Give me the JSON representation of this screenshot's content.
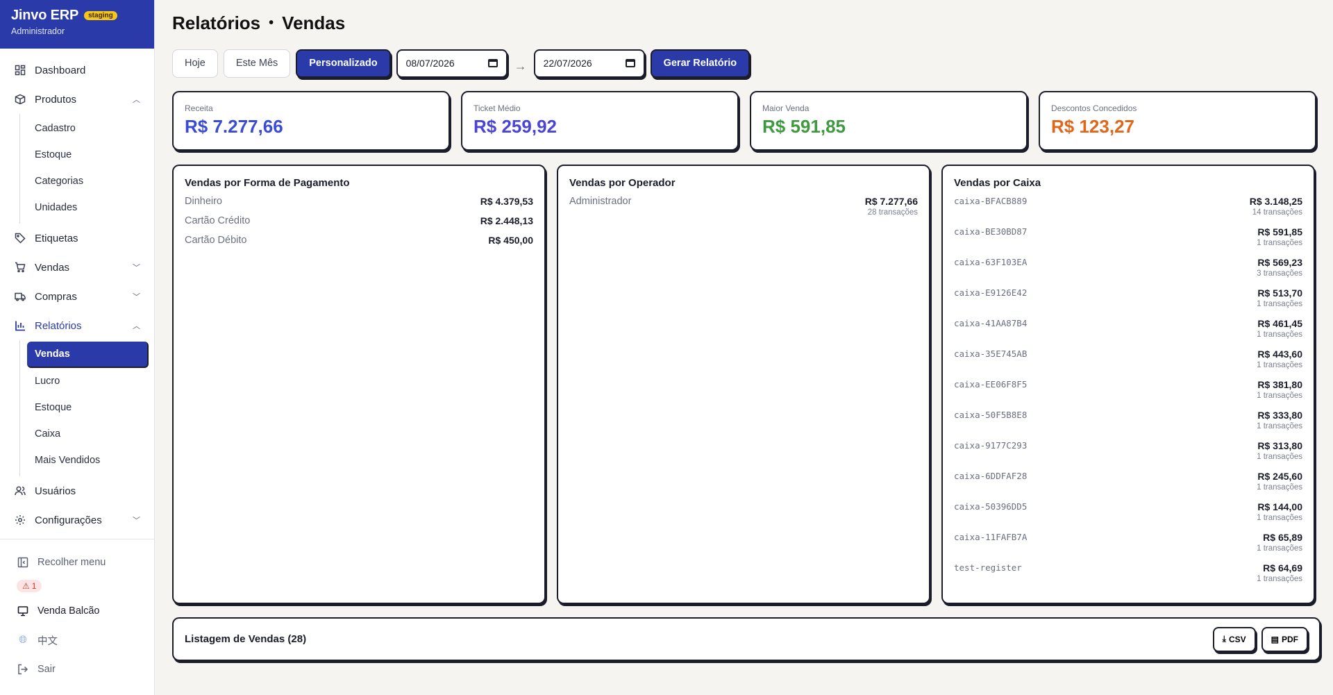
{
  "brand": {
    "title": "Jinvo ERP",
    "badge": "staging",
    "user": "Administrador"
  },
  "nav": {
    "dashboard": "Dashboard",
    "produtos": "Produtos",
    "produtos_sub": [
      "Cadastro",
      "Estoque",
      "Categorias",
      "Unidades"
    ],
    "etiquetas": "Etiquetas",
    "vendas": "Vendas",
    "compras": "Compras",
    "relatorios": "Relatórios",
    "relatorios_sub": [
      "Vendas",
      "Lucro",
      "Estoque",
      "Caixa",
      "Mais Vendidos"
    ],
    "usuarios": "Usuários",
    "configuracoes": "Configurações"
  },
  "footer": {
    "collapse": "Recolher menu",
    "alert_count": "1",
    "venda_balcao": "Venda Balcão",
    "language": "中文",
    "logout": "Sair"
  },
  "page": {
    "section": "Relatórios",
    "separator": "•",
    "title": "Vendas"
  },
  "filters": {
    "today": "Hoje",
    "this_month": "Este Mês",
    "custom": "Personalizado",
    "date_from": "08/07/2026",
    "date_to": "22/07/2026",
    "arrow": "→",
    "generate": "Gerar Relatório"
  },
  "stats": [
    {
      "label": "Receita",
      "value": "R$ 7.277,66",
      "color": "#3a4bd6"
    },
    {
      "label": "Ticket Médio",
      "value": "R$ 259,92",
      "color": "#4b44d8"
    },
    {
      "label": "Maior Venda",
      "value": "R$ 591,85",
      "color": "#3f9a3f"
    },
    {
      "label": "Descontos Concedidos",
      "value": "R$ 123,27",
      "color": "#e0661a"
    }
  ],
  "payment": {
    "title": "Vendas por Forma de Pagamento",
    "rows": [
      {
        "label": "Dinheiro",
        "value": "R$ 4.379,53"
      },
      {
        "label": "Cartão Crédito",
        "value": "R$ 2.448,13"
      },
      {
        "label": "Cartão Débito",
        "value": "R$ 450,00"
      }
    ]
  },
  "operator": {
    "title": "Vendas por Operador",
    "rows": [
      {
        "label": "Administrador",
        "value": "R$ 7.277,66",
        "sub": "28 transações"
      }
    ]
  },
  "register": {
    "title": "Vendas por Caixa",
    "rows": [
      {
        "label": "caixa-BFACB889",
        "value": "R$ 3.148,25",
        "sub": "14 transações"
      },
      {
        "label": "caixa-BE30BD87",
        "value": "R$ 591,85",
        "sub": "1 transações"
      },
      {
        "label": "caixa-63F103EA",
        "value": "R$ 569,23",
        "sub": "3 transações"
      },
      {
        "label": "caixa-E9126E42",
        "value": "R$ 513,70",
        "sub": "1 transações"
      },
      {
        "label": "caixa-41AA87B4",
        "value": "R$ 461,45",
        "sub": "1 transações"
      },
      {
        "label": "caixa-35E745AB",
        "value": "R$ 443,60",
        "sub": "1 transações"
      },
      {
        "label": "caixa-EE06F8F5",
        "value": "R$ 381,80",
        "sub": "1 transações"
      },
      {
        "label": "caixa-50F5B8E8",
        "value": "R$ 333,80",
        "sub": "1 transações"
      },
      {
        "label": "caixa-9177C293",
        "value": "R$ 313,80",
        "sub": "1 transações"
      },
      {
        "label": "caixa-6DDFAF28",
        "value": "R$ 245,60",
        "sub": "1 transações"
      },
      {
        "label": "caixa-50396DD5",
        "value": "R$ 144,00",
        "sub": "1 transações"
      },
      {
        "label": "caixa-11FAFB7A",
        "value": "R$ 65,89",
        "sub": "1 transações"
      },
      {
        "label": "test-register",
        "value": "R$ 64,69",
        "sub": "1 transações"
      }
    ]
  },
  "listing": {
    "title": "Listagem de Vendas (28)",
    "csv": "CSV",
    "pdf": "PDF"
  }
}
